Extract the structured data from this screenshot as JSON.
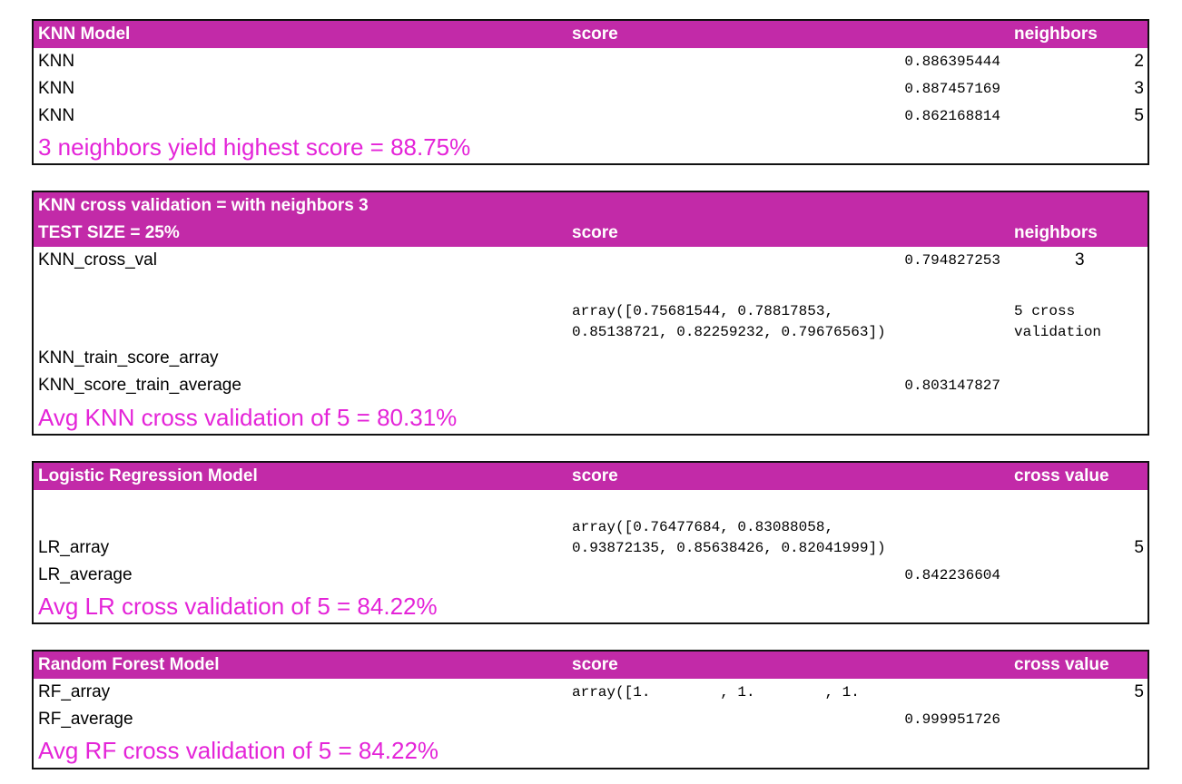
{
  "colors": {
    "header_bg": "#c22aa8",
    "header_text": "#ffffff",
    "highlight_text": "#e424d8"
  },
  "knn_model": {
    "header": {
      "c1": "KNN Model",
      "c2": "score",
      "c3": "neighbors"
    },
    "rows": [
      {
        "name": "KNN",
        "score": "0.886395444",
        "neighbors": "2"
      },
      {
        "name": "KNN",
        "score": "0.887457169",
        "neighbors": "3"
      },
      {
        "name": "KNN",
        "score": "0.862168814",
        "neighbors": "5"
      }
    ],
    "summary": "3 neighbors yield highest score = 88.75%"
  },
  "knn_cv": {
    "header_line1": "KNN cross validation  = with neighbors 3",
    "header": {
      "c1": "TEST SIZE = 25%",
      "c2": "score",
      "c3": "neighbors"
    },
    "cross_val": {
      "name": "KNN_cross_val",
      "score": "0.794827253",
      "neighbors": "3"
    },
    "array_line1": "array([0.75681544, 0.78817853,",
    "array_line2": "0.85138721, 0.82259232, 0.79676563])",
    "note_line1": "5 cross",
    "note_line2": "validation",
    "train_array_label": "KNN_train_score_array",
    "train_avg": {
      "name": "KNN_score_train_average",
      "score": "0.803147827"
    },
    "summary": "Avg KNN cross validation of 5  =  80.31%"
  },
  "lr_model": {
    "header": {
      "c1": "Logistic Regression Model",
      "c2": "score",
      "c3": "cross value"
    },
    "array_line1": "array([0.76477684, 0.83088058,",
    "array_line2": "0.93872135, 0.85638426, 0.82041999])",
    "array_label": "LR_array",
    "cross_value": "5",
    "avg": {
      "name": "LR_average",
      "score": "0.842236604"
    },
    "summary": "Avg LR cross validation of 5  =  84.22%"
  },
  "rf_model": {
    "header": {
      "c1": "Random Forest Model",
      "c2": "score",
      "c3": "cross value"
    },
    "array": {
      "name": "RF_array",
      "value": "array([1.        , 1.        , 1.",
      "cross_value": "5"
    },
    "avg": {
      "name": "RF_average",
      "score": "0.999951726"
    },
    "summary": "Avg RF cross validation of 5  =  84.22%"
  }
}
